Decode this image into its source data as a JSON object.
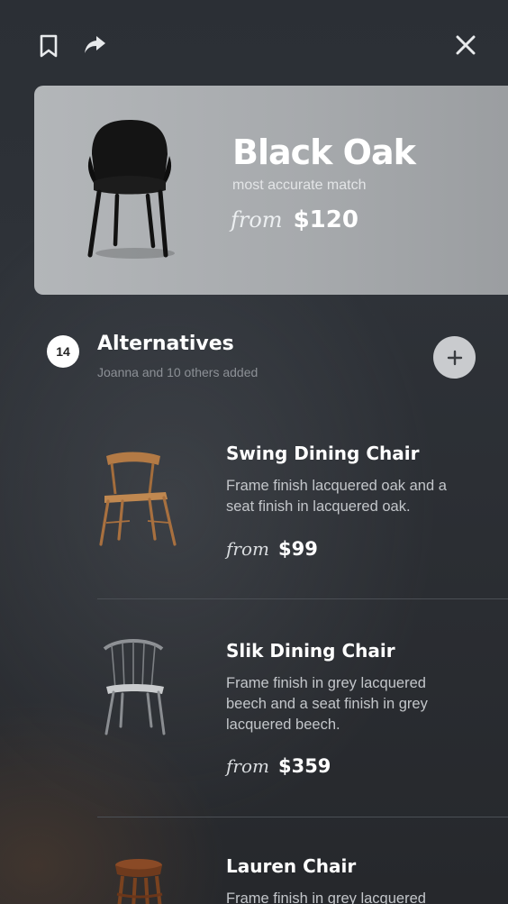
{
  "header": {
    "icons": [
      "bookmark-icon",
      "share-icon",
      "close-icon"
    ]
  },
  "match": {
    "title": "Black Oak",
    "subtitle": "most accurate match",
    "from_label": "from",
    "price": "$120"
  },
  "alternatives": {
    "count": "14",
    "title": "Alternatives",
    "subtitle": "Joanna and 10 others added",
    "items": [
      {
        "name": "Swing Dining Chair",
        "description": "Frame finish lacquered oak and a seat finish in lacquered oak.",
        "from_label": "from",
        "price": "$99"
      },
      {
        "name": "Slik Dining Chair",
        "description": "Frame finish in grey lacquered beech and a seat finish in grey lacquered beech.",
        "from_label": "from",
        "price": "$359"
      },
      {
        "name": "Lauren Chair",
        "description": "Frame finish in grey lacquered",
        "from_label": "from",
        "price": ""
      }
    ]
  },
  "colors": {
    "background": "#2b2f35",
    "card": "#a9acaf",
    "accent_text": "#ffffff",
    "muted_text": "#8c9096"
  }
}
